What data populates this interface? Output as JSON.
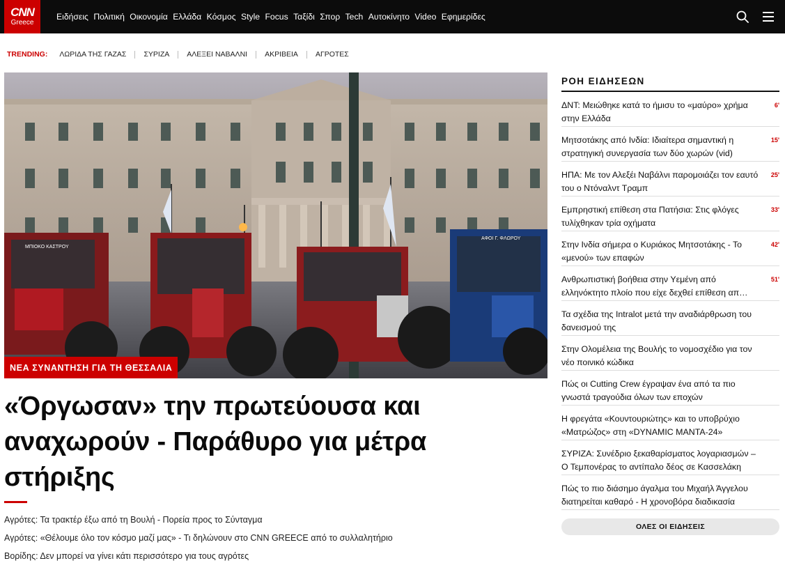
{
  "brand": {
    "logo_main": "CNN",
    "logo_sub": "Greece",
    "accent": "#cc0000",
    "topbar_bg": "#0c0c0c"
  },
  "nav": {
    "items": [
      "Ειδήσεις",
      "Πολιτική",
      "Οικονομία",
      "Ελλάδα",
      "Κόσμος",
      "Style",
      "Focus",
      "Ταξίδι",
      "Σπορ",
      "Tech",
      "Αυτοκίνητο",
      "Video",
      "Εφημερίδες"
    ],
    "icons": [
      "search-icon",
      "menu-icon"
    ]
  },
  "trending": {
    "label": "TRENDING:",
    "items": [
      "ΛΩΡΙΔΑ ΤΗΣ ΓΑΖΑΣ",
      "ΣΥΡΙΖΑ",
      "ΑΛΕΞΕΙ ΝΑΒΑΛΝΙ",
      "ΑΚΡΙΒΕΙΑ",
      "ΑΓΡΟΤΕΣ"
    ]
  },
  "hero": {
    "tag": "ΝΕΑ ΣΥΝΑΝΤΗΣΗ ΓΙΑ ΤΗ ΘΕΣΣΑΛΙΑ",
    "headline": "«Όργωσαν» την πρωτεύουσα και αναχωρούν - Παράθυρο για μέτρα στήριξης",
    "tractor_plates": [
      "ΜΠΙΟΚΟ ΚΑΣΤΡΟΥ",
      "ΑΦΟΙ Γ. ΦΛΩΡΟΥ"
    ],
    "related": [
      "Αγρότες: Τα τρακτέρ έξω από τη Βουλή - Πορεία προς το Σύνταγμα",
      "Αγρότες: «Θέλουμε όλο τον κόσμο μαζί μας» - Τι δηλώνουν στο CNN GREECE από το συλλαλητήριο",
      "Βορίδης: Δεν μπορεί να γίνει κάτι περισσότερο για τους αγρότες"
    ]
  },
  "sidebar": {
    "title": "ΡΟΗ ΕΙΔΗΣΕΩΝ",
    "items": [
      {
        "text": "ΔΝΤ: Μειώθηκε κατά το ήμισυ το «μαύρο» χρήμα στην Ελλάδα",
        "minutes": "6'"
      },
      {
        "text": "Μητσοτάκης από Ινδία: Ιδιαίτερα σημαντική η στρατηγική συνεργασία των δύο χωρών (vid)",
        "minutes": "15'"
      },
      {
        "text": "ΗΠΑ: Με τον Αλεξέι Ναβάλνι παρομοιάζει τον εαυτό του ο Ντόναλντ Τραμπ",
        "minutes": "25'"
      },
      {
        "text": "Εμπρηστική επίθεση στα Πατήσια: Στις φλόγες τυλίχθηκαν τρία οχήματα",
        "minutes": "33'"
      },
      {
        "text": "Στην Ινδία σήμερα ο Κυριάκος Μητσοτάκης - Το «μενού» των επαφών",
        "minutes": "42'"
      },
      {
        "text": "Ανθρωπιστική βοήθεια στην Υεμένη από ελληνόκτητο πλοίο που είχε δεχθεί επίθεση απ…",
        "minutes": "51'"
      },
      {
        "text": "Τα σχέδια της Intralot μετά την αναδιάρθρωση του δανεισμού της",
        "minutes": ""
      },
      {
        "text": "Στην Ολομέλεια της Βουλής το νομοσχέδιο για τον νέο ποινικό κώδικα",
        "minutes": ""
      },
      {
        "text": "Πώς οι Cutting Crew έγραψαν ένα από τα πιο γνωστά τραγούδια όλων των εποχών",
        "minutes": ""
      },
      {
        "text": "Η φρεγάτα «Κουντουριώτης» και το υποβρύχιο «Ματρώζος» στη «DYNAMIC MANTA-24»",
        "minutes": ""
      },
      {
        "text": "ΣΥΡΙΖΑ: Συνέδριο ξεκαθαρίσματος λογαριασμών – Ο Τεμπονέρας το αντίπαλο δέος σε Κασσελάκη",
        "minutes": ""
      },
      {
        "text": "Πώς το πιο διάσημο άγαλμα του Μιχαήλ Άγγελου διατηρείται καθαρό - Η χρονοβόρα διαδικασία",
        "minutes": ""
      }
    ],
    "all_news_label": "ΟΛΕΣ ΟΙ ΕΙΔΗΣΕΙΣ"
  }
}
